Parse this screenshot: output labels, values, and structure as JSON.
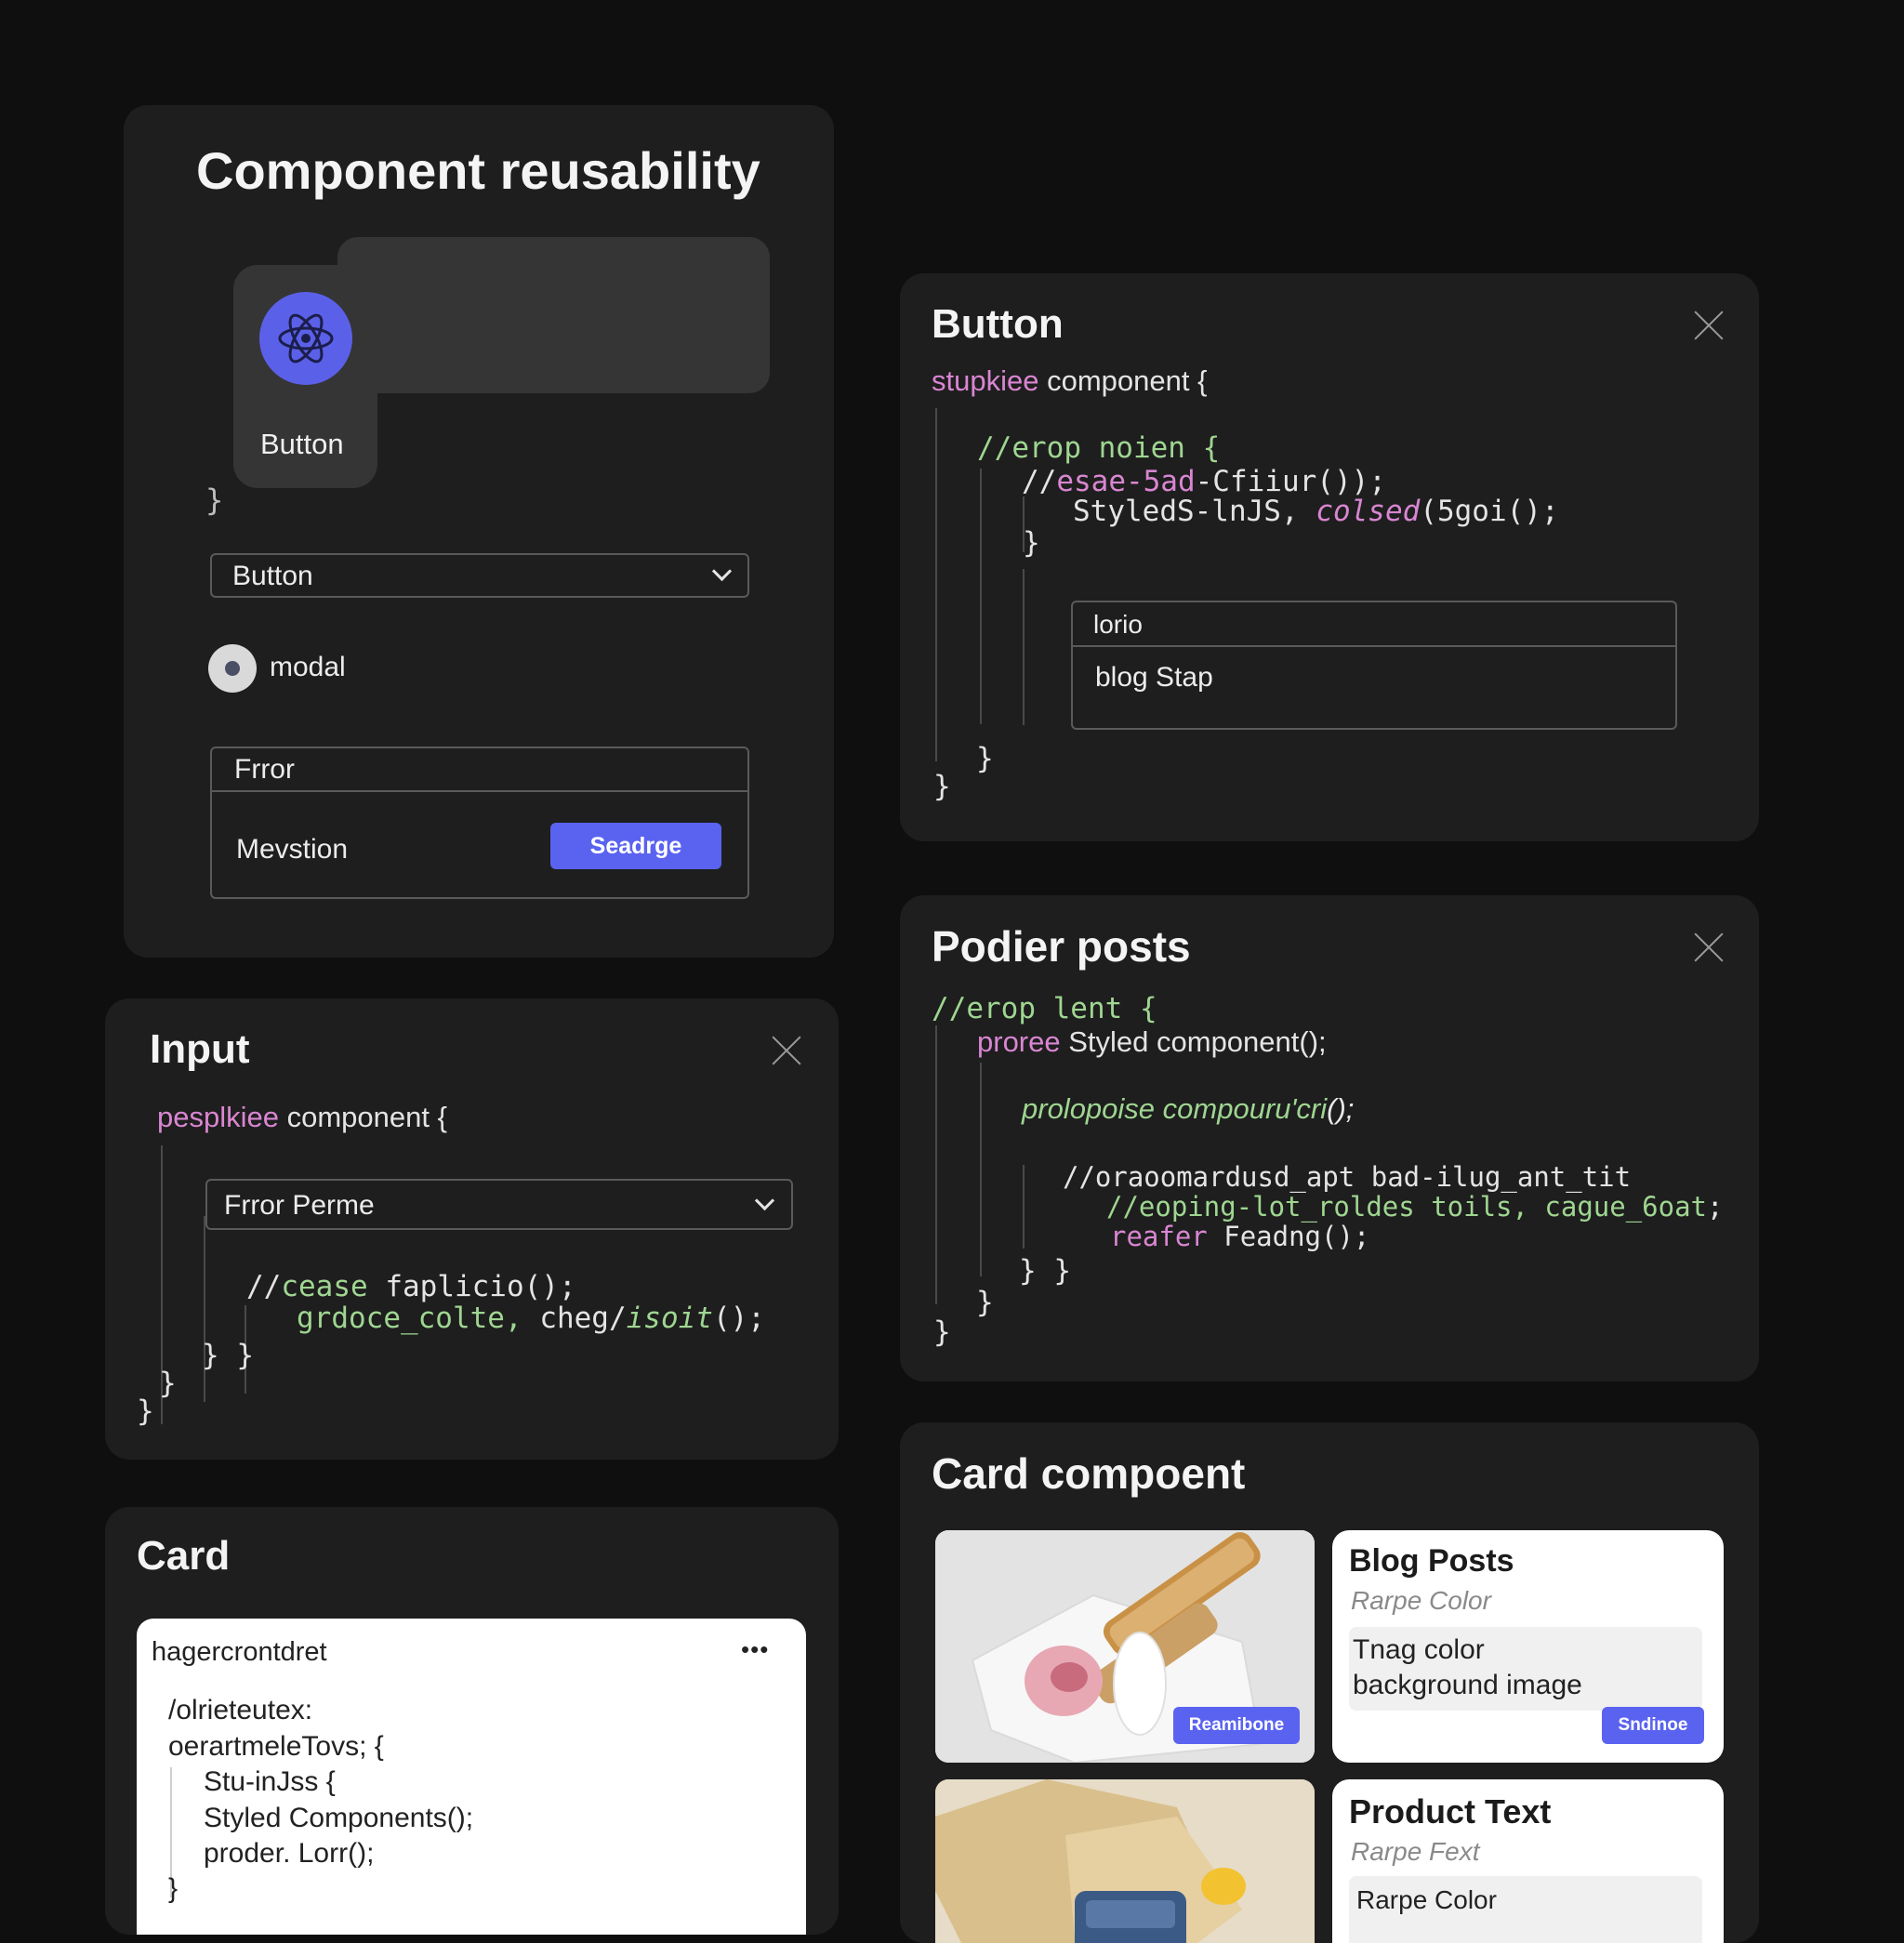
{
  "reuse": {
    "title": "Component reusability",
    "button_label": "Button",
    "closing_brace": "}",
    "select_value": "Button",
    "radio_label": "modal",
    "group_title": "Frror",
    "group_text": "Mevstion",
    "group_button": "Seadrge"
  },
  "button_panel": {
    "title": "Button",
    "line1_kw": "stupkiee",
    "line1_rest": "component {",
    "line2": "//erop noien {",
    "line3_a": "//",
    "line3_b": "esae-5ad",
    "line3_c": "-Cfiiur());",
    "line4_a": "StyledS-lnJS,",
    "line4_b": "colsed",
    "line4_c": "(5goi();",
    "close_inner": "}",
    "box_title": "lorio",
    "box_text": "blog Stap",
    "close_mid": "}",
    "close_outer": "}"
  },
  "poster_panel": {
    "title": "Podier posts",
    "line1": "//erop lent {",
    "line2_kw": "proree",
    "line2_rest": "Styled component();",
    "line3_a": "prolopoise compouru'cri",
    "line3_b": "();",
    "line4": "//oraoomardusd_apt bad-ilug_ant_tit",
    "line5_a": "//eoping-lot_roldes  toils,",
    "line5_b": "cague_6oat",
    "line5_c": ";",
    "line6_a": "reafer",
    "line6_b": "Feadng();",
    "close1": "}  }",
    "close2": "}",
    "close3": "}"
  },
  "input_panel": {
    "title": "Input",
    "line1_kw": "pesplkiee",
    "line1_rest": "component {",
    "select_value": "Frror Perme",
    "line2_a": "//",
    "line2_b": "cease",
    "line2_c": "faplicio();",
    "line3_a": "grdoce_colte,",
    "line3_b": "cheg/",
    "line3_c": "isoit",
    "line3_d": "();",
    "close1": "}  }",
    "close2": "}",
    "close3": "}"
  },
  "card_panel": {
    "title": "Card",
    "inner_title": "hagercrontdret",
    "menu": "•••",
    "lines": [
      "/olrieteutex:",
      "oerartmeleTovs; {",
      "Stu-inJss {",
      "Styled Components();",
      "proder. Lorr();",
      "}"
    ]
  },
  "card_component": {
    "title": "Card compoent",
    "image_button": "Reamibone",
    "blog_title": "Blog Posts",
    "blog_sub": "Rarpe Color",
    "blog_box_1": "Tnag color",
    "blog_box_2": "background image",
    "blog_button": "Sndinoe",
    "product_title": "Product Text",
    "product_sub": "Rarpe Fext",
    "product_box": "Rarpe Color"
  },
  "colors": {
    "accent_blue": "#5a63f0",
    "react_icon_bg": "#5b60e8",
    "panel_bg": "#1e1e1e",
    "page_bg": "#0f0f0f",
    "keyword_pink": "#d986d2",
    "comment_green": "#9fd691"
  },
  "icons": [
    "react-atom-icon",
    "chevron-down-icon",
    "radio-dot-icon",
    "close-icon",
    "more-dots-icon"
  ]
}
